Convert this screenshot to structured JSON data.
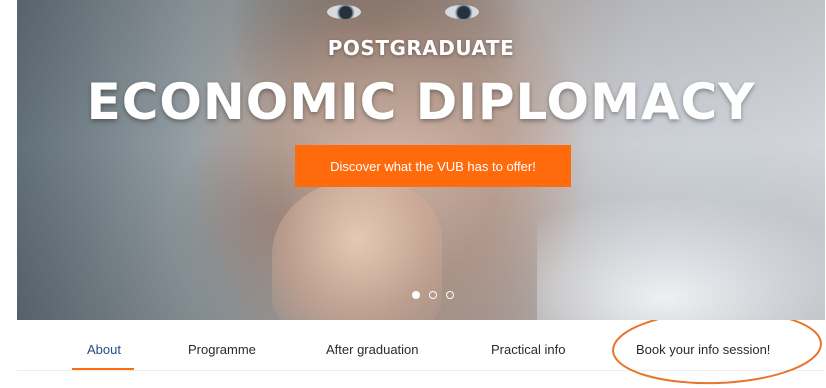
{
  "hero": {
    "kicker": "POSTGRADUATE",
    "headline": "ECONOMIC DIPLOMACY",
    "cta_label": "Discover what the VUB has to offer!",
    "carousel": {
      "slide_count": 3,
      "active_index": 0
    }
  },
  "nav": {
    "tabs": [
      {
        "label": "About",
        "active": true
      },
      {
        "label": "Programme"
      },
      {
        "label": "After graduation"
      },
      {
        "label": "Practical info"
      },
      {
        "label": "Book your info session!",
        "highlighted": true
      }
    ]
  },
  "colors": {
    "accent": "#ff6a0c",
    "active_tab": "#1f4e86",
    "annotation_ring": "#e8752c"
  }
}
